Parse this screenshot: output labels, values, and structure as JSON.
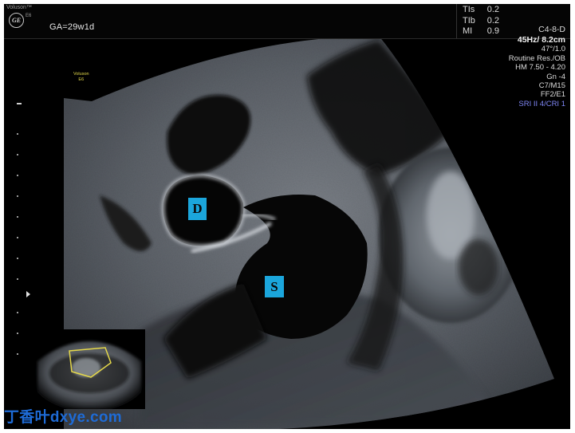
{
  "header": {
    "brand": "Voluson™",
    "logo_text": "GE",
    "model_small": "E6",
    "ga": "GA=29w1d"
  },
  "indices": [
    {
      "label": "TIs",
      "value": "0.2"
    },
    {
      "label": "TIb",
      "value": "0.2"
    },
    {
      "label": "MI",
      "value": "0.9"
    }
  ],
  "probe": "C4-8-D",
  "params": {
    "frame_depth": "45Hz/ 8.2cm",
    "angle": "47°/1.0",
    "preset": "Routine Res./OB",
    "harmonic": "HM  7.50 - 4.20",
    "gain": "Gn  -4",
    "map": "C7/M15",
    "filter": "FF2/E1",
    "sri": "SRI II 4/CRI 1"
  },
  "mini_label": {
    "brand": "Voluson",
    "model": "E6"
  },
  "markers": {
    "d": "D",
    "s": "S"
  },
  "watermark": {
    "cn": "丁香叶",
    "en": "dxye.com"
  },
  "colors": {
    "marker_bg": "#1ba6dc",
    "sri_text": "#7f86f5",
    "mini_label": "#e2d84a",
    "watermark": "#1e6bd6"
  },
  "icons": {
    "logo": "ge-logo-icon"
  }
}
